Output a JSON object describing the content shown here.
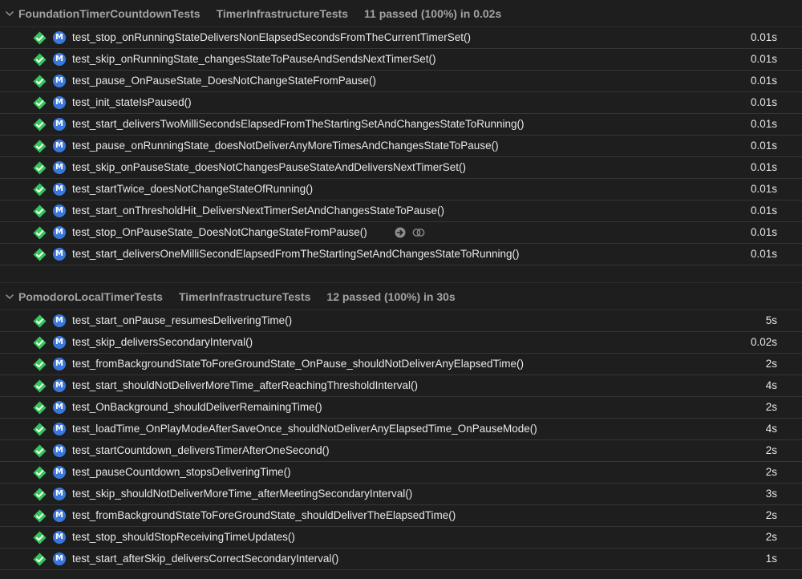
{
  "groups": [
    {
      "name": "FoundationTimerCountdownTests",
      "parent": "TimerInfrastructureTests",
      "status": "11 passed (100%) in 0.02s",
      "tests": [
        {
          "name": "test_stop_onRunningStateDeliversNonElapsedSecondsFromTheCurrentTimerSet()",
          "duration": "0.01s"
        },
        {
          "name": "test_skip_onRunningState_changesStateToPauseAndSendsNextTimerSet()",
          "duration": "0.01s"
        },
        {
          "name": "test_pause_OnPauseState_DoesNotChangeStateFromPause()",
          "duration": "0.01s"
        },
        {
          "name": "test_init_stateIsPaused()",
          "duration": "0.01s"
        },
        {
          "name": "test_start_deliversTwoMilliSecondsElapsedFromTheStartingSetAndChangesStateToRunning()",
          "duration": "0.01s"
        },
        {
          "name": "test_pause_onRunningState_doesNotDeliverAnyMoreTimesAndChangesStateToPause()",
          "duration": "0.01s"
        },
        {
          "name": "test_skip_onPauseState_doesNotChangesPauseStateAndDeliversNextTimerSet()",
          "duration": "0.01s"
        },
        {
          "name": "test_startTwice_doesNotChangeStateOfRunning()",
          "duration": "0.01s"
        },
        {
          "name": "test_start_onThresholdHit_DeliversNextTimerSetAndChangesStateToPause()",
          "duration": "0.01s"
        },
        {
          "name": "test_stop_OnPauseState_DoesNotChangeStateFromPause()",
          "duration": "0.01s",
          "has_actions": true
        },
        {
          "name": "test_start_deliversOneMilliSecondElapsedFromTheStartingSetAndChangesStateToRunning()",
          "duration": "0.01s"
        }
      ]
    },
    {
      "name": "PomodoroLocalTimerTests",
      "parent": "TimerInfrastructureTests",
      "status": "12 passed (100%) in 30s",
      "tests": [
        {
          "name": "test_start_onPause_resumesDeliveringTime()",
          "duration": "5s"
        },
        {
          "name": "test_skip_deliversSecondaryInterval()",
          "duration": "0.02s"
        },
        {
          "name": "test_fromBackgroundStateToForeGroundState_OnPause_shouldNotDeliverAnyElapsedTime()",
          "duration": "2s"
        },
        {
          "name": "test_start_shouldNotDeliverMoreTime_afterReachingThresholdInterval()",
          "duration": "4s"
        },
        {
          "name": "test_OnBackground_shouldDeliverRemainingTime()",
          "duration": "2s"
        },
        {
          "name": "test_loadTime_OnPlayModeAfterSaveOnce_shouldNotDeliverAnyElapsedTime_OnPauseMode()",
          "duration": "4s"
        },
        {
          "name": "test_startCountdown_deliversTimerAfterOneSecond()",
          "duration": "2s"
        },
        {
          "name": "test_pauseCountdown_stopsDeliveringTime()",
          "duration": "2s"
        },
        {
          "name": "test_skip_shouldNotDeliverMoreTime_afterMeetingSecondaryInterval()",
          "duration": "3s"
        },
        {
          "name": "test_fromBackgroundStateToForeGroundState_shouldDeliverTheElapsedTime()",
          "duration": "2s"
        },
        {
          "name": "test_stop_shouldStopReceivingTimeUpdates()",
          "duration": "2s"
        },
        {
          "name": "test_start_afterSkip_deliversCorrectSecondaryInterval()",
          "duration": "1s"
        }
      ]
    }
  ],
  "icons": {
    "pass": "checkmark-diamond-icon",
    "method": "method-m-icon",
    "jump": "arrow-right-circle-icon",
    "coverage": "link-circles-icon",
    "disclosure": "chevron-down-icon"
  },
  "icon_glyphs": {
    "method": "M"
  },
  "colors": {
    "background": "#1e1e1e",
    "pass_green": "#34c759",
    "method_blue": "#3a78dd",
    "header_text": "#a3a3a3"
  }
}
